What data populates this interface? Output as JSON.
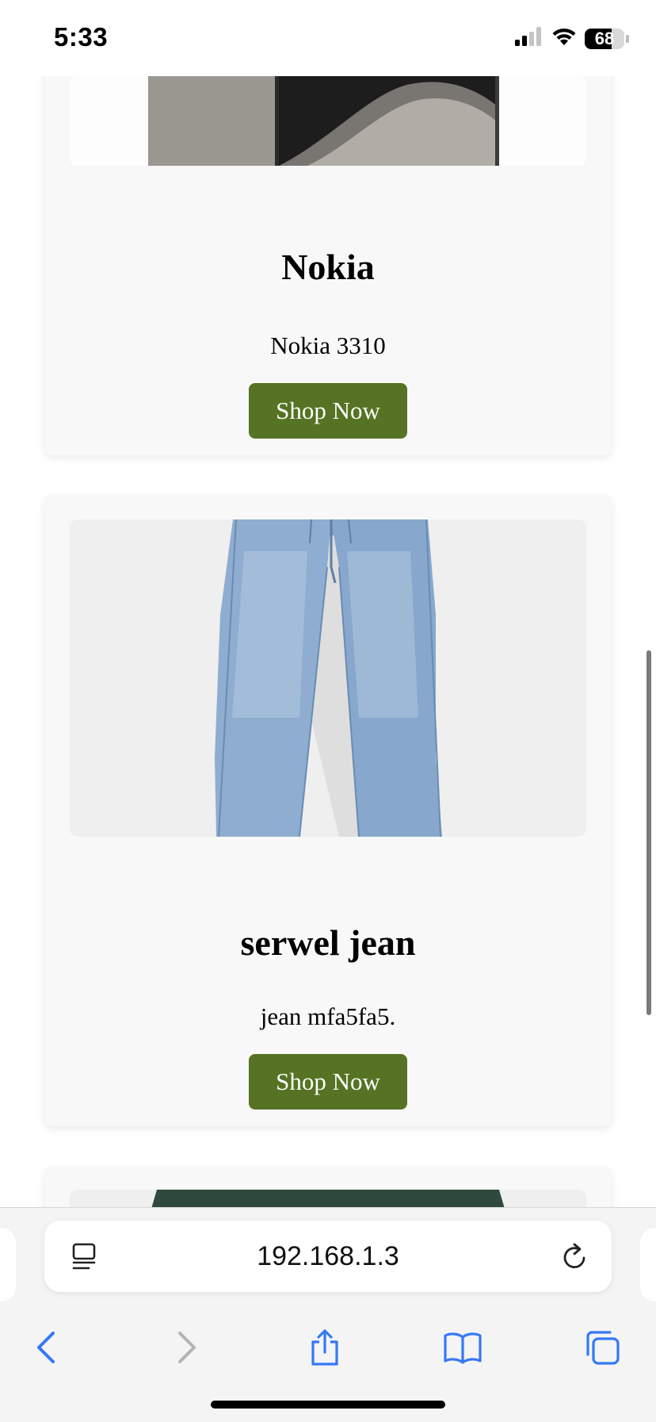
{
  "status_bar": {
    "time": "5:33",
    "battery_level": "68",
    "battery_percent": 68
  },
  "products": [
    {
      "title": "Nokia",
      "description": "Nokia 3310",
      "button_label": "Shop Now"
    },
    {
      "title": "serwel jean",
      "description": "jean mfa5fa5.",
      "button_label": "Shop Now"
    }
  ],
  "browser": {
    "url": "192.168.1.3"
  },
  "colors": {
    "button_bg": "#557323",
    "card_bg": "#f8f8f8",
    "ios_blue": "#3478f6"
  },
  "icons": {
    "signal": "cellular-signal-icon",
    "wifi": "wifi-icon",
    "reader": "reader-view-icon",
    "reload": "reload-icon",
    "back": "back-chevron-icon",
    "forward": "forward-chevron-icon",
    "share": "share-icon",
    "bookmarks": "bookmarks-icon",
    "tabs": "tabs-icon"
  }
}
